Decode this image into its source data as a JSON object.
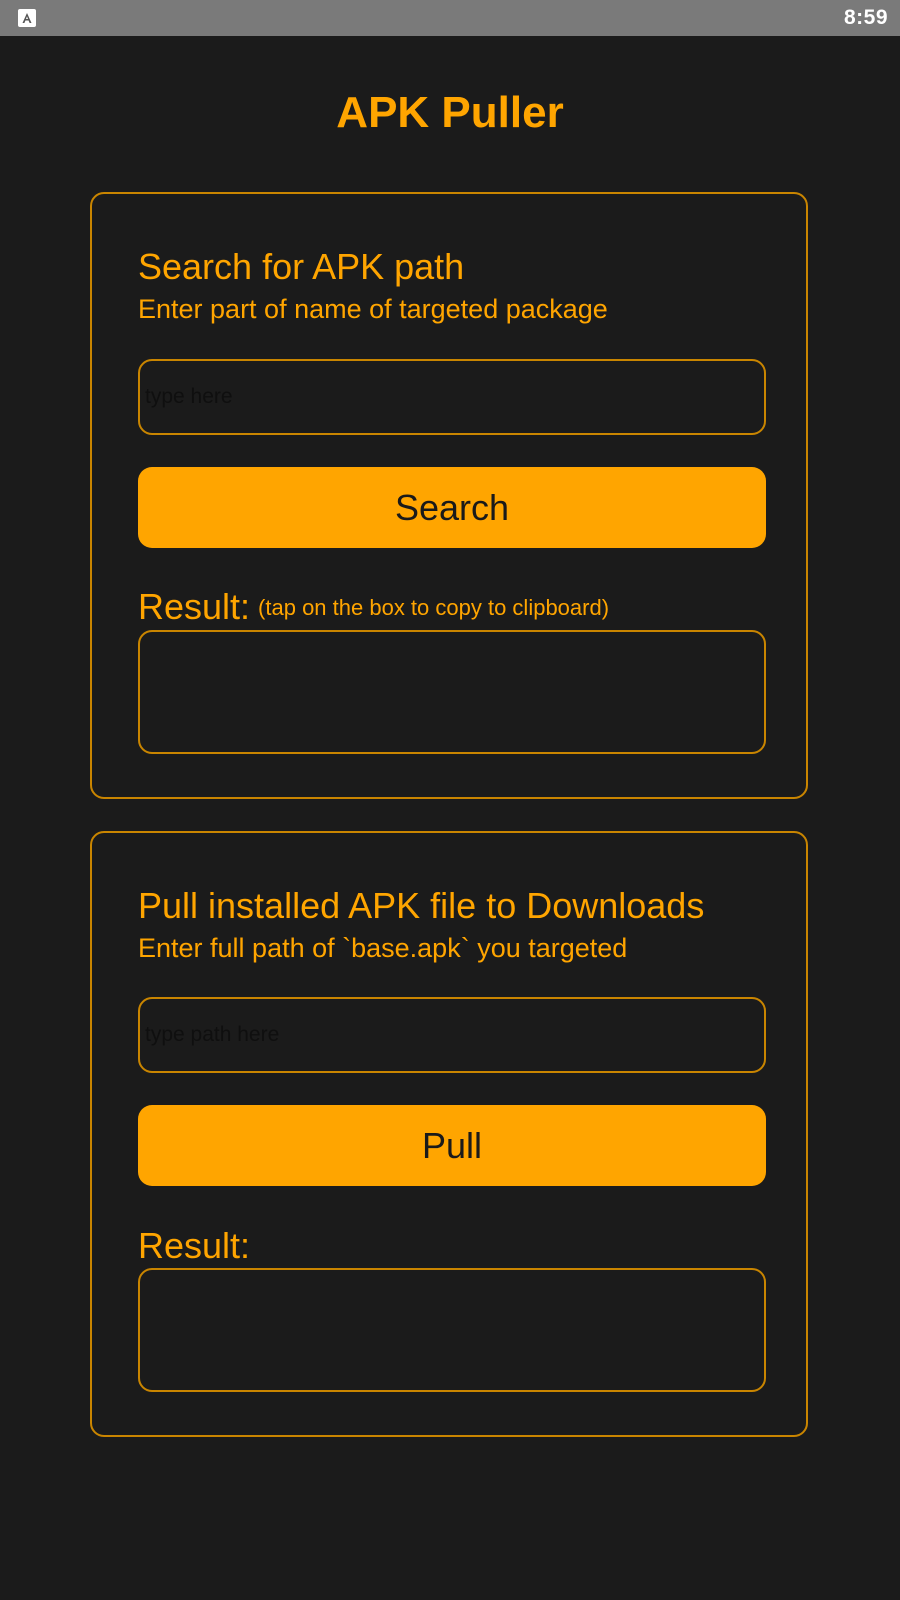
{
  "status_bar": {
    "time": "8:59",
    "app_icon": "app-store-icon"
  },
  "app": {
    "title": "APK Puller"
  },
  "search_section": {
    "title": "Search for APK path",
    "subtitle": "Enter part of name of targeted package",
    "input_placeholder": "type here",
    "input_value": "",
    "button_label": "Search",
    "result_label": "Result:",
    "result_hint": "(tap on the box to copy to clipboard)",
    "result_value": ""
  },
  "pull_section": {
    "title": "Pull installed APK file to Downloads",
    "subtitle": "Enter full path of `base.apk` you targeted",
    "input_placeholder": "type path here",
    "input_value": "",
    "button_label": "Pull",
    "result_label": "Result:",
    "result_value": ""
  },
  "colors": {
    "background": "#1b1b1b",
    "accent": "#ffa500",
    "border": "#c98500",
    "status_bar": "#7a7a7a"
  }
}
